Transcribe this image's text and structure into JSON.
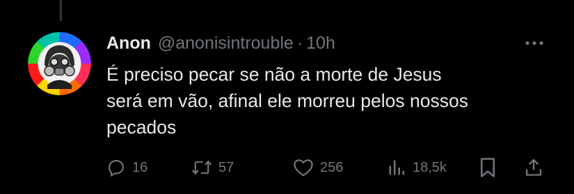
{
  "tweet": {
    "author_name": "Anon",
    "handle": "@anonisintrouble",
    "separator": "·",
    "time": "10h",
    "text": "É preciso pecar se não a morte de Jesus\nserá em vão, afinal ele morreu pelos nossos\npecados"
  },
  "actions": {
    "replies": "16",
    "reposts": "57",
    "likes": "256",
    "views": "18,5k"
  },
  "icons": {
    "more": "more-horizontal-icon",
    "reply": "reply-icon",
    "repost": "repost-icon",
    "like": "heart-icon",
    "views": "views-icon",
    "bookmark": "bookmark-icon",
    "share": "share-icon"
  },
  "colors": {
    "background": "#000000",
    "text": "#e7e9ea",
    "secondary": "#71767b",
    "thread_line": "#333639"
  }
}
